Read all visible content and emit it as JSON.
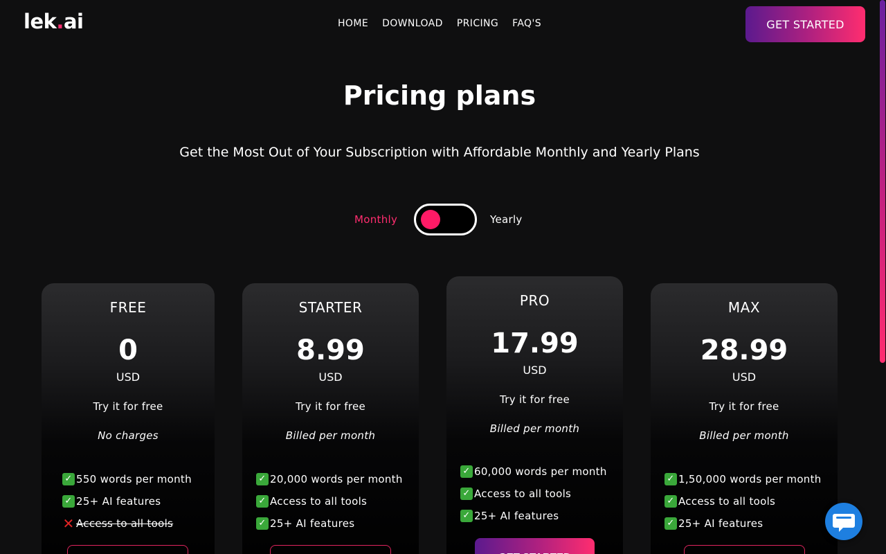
{
  "header": {
    "logo_main": "lek",
    "logo_dot": ".",
    "logo_end": "ai",
    "nav": [
      "HOME",
      "DOWNLOAD",
      "PRICING",
      "FAQ'S"
    ],
    "cta_label": "GET STARTED"
  },
  "hero": {
    "title": "Pricing plans",
    "subtitle": "Get the Most Out of Your Subscription with Affordable Monthly and Yearly Plans"
  },
  "billing_toggle": {
    "left_label": "Monthly",
    "right_label": "Yearly",
    "selected": "Monthly"
  },
  "plans": [
    {
      "name": "FREE",
      "price": "0",
      "currency": "USD",
      "try": "Try it for free",
      "billing": "No charges",
      "features": [
        {
          "icon": "check-icon",
          "text": "550 words per month"
        },
        {
          "icon": "check-icon",
          "text": "25+ AI features"
        },
        {
          "icon": "cross-icon",
          "text": "Access to all tools"
        }
      ]
    },
    {
      "name": "STARTER",
      "price": "8.99",
      "currency": "USD",
      "try": "Try it for free",
      "billing": "Billed per month",
      "features": [
        {
          "icon": "check-icon",
          "text": "20,000 words per month"
        },
        {
          "icon": "check-icon",
          "text": "Access to all tools"
        },
        {
          "icon": "check-icon",
          "text": "25+ AI features"
        }
      ]
    },
    {
      "name": "PRO",
      "price": "17.99",
      "currency": "USD",
      "try": "Try it for free",
      "billing": "Billed per month",
      "features": [
        {
          "icon": "check-icon",
          "text": "60,000 words per month"
        },
        {
          "icon": "check-icon",
          "text": "Access to all tools"
        },
        {
          "icon": "check-icon",
          "text": "25+ AI features"
        }
      ],
      "button_label": "GET STARTED"
    },
    {
      "name": "MAX",
      "price": "28.99",
      "currency": "USD",
      "try": "Try it for free",
      "billing": "Billed per month",
      "features": [
        {
          "icon": "check-icon",
          "text": "1,50,000 words per month"
        },
        {
          "icon": "check-icon",
          "text": "Access to all tools"
        },
        {
          "icon": "check-icon",
          "text": "25+ AI features"
        }
      ]
    }
  ],
  "colors": {
    "background": "#0f0f10",
    "accent": "#ff2d6f",
    "gradient_start": "#5b1a8e",
    "check_green": "#3aa83a",
    "cross_red": "#e02424",
    "chat_blue": "#1e7fe0"
  }
}
